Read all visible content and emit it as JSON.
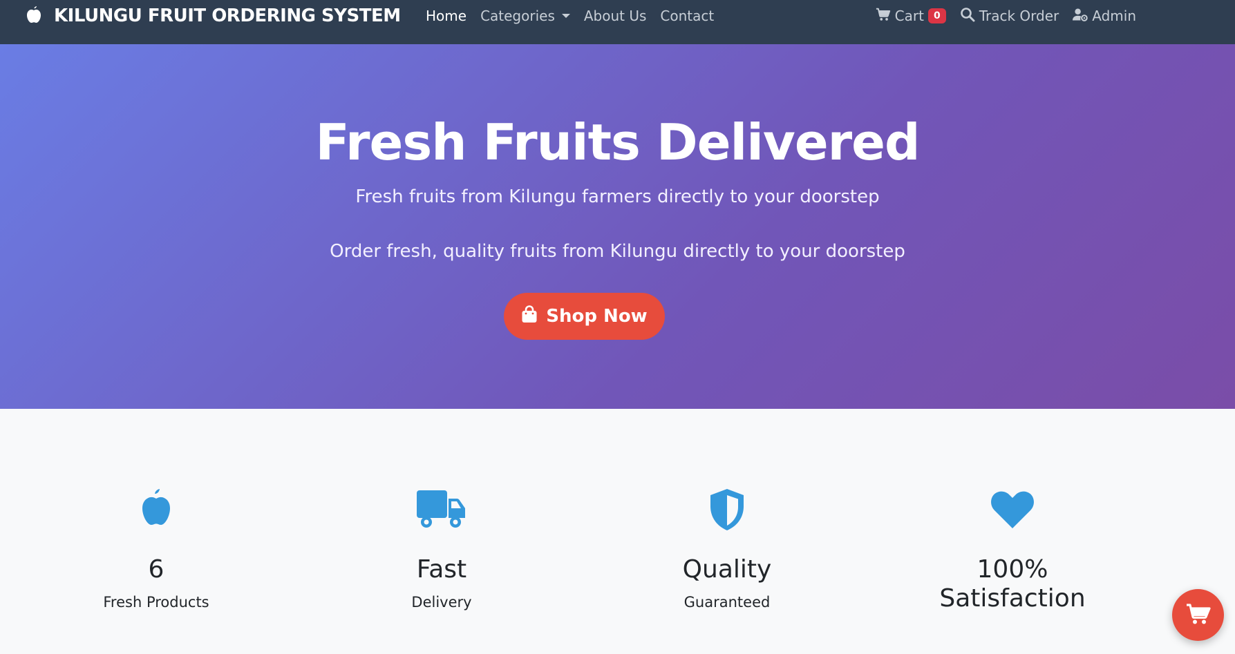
{
  "navbar": {
    "brand": "KILUNGU FRUIT ORDERING SYSTEM",
    "brand_icon": "apple-icon",
    "links": [
      {
        "label": "Home",
        "active": true
      },
      {
        "label": "Categories",
        "dropdown": true
      },
      {
        "label": "About Us"
      },
      {
        "label": "Contact"
      }
    ],
    "cart_label": "Cart",
    "cart_count": "0",
    "track_label": "Track Order",
    "admin_label": "Admin"
  },
  "hero": {
    "title": "Fresh Fruits Delivered",
    "subtitle": "Fresh fruits from Kilungu farmers directly to your doorstep",
    "tagline": "Order fresh, quality fruits from Kilungu directly to your doorstep",
    "button_label": "Shop Now",
    "button_icon": "shopping-bag-icon"
  },
  "features": [
    {
      "icon": "apple-icon",
      "title": "6",
      "desc": "Fresh Products"
    },
    {
      "icon": "truck-icon",
      "title": "Fast",
      "desc": "Delivery"
    },
    {
      "icon": "shield-icon",
      "title": "Quality",
      "desc": "Guaranteed"
    },
    {
      "icon": "heart-icon",
      "title": "100%\nSatisfaction",
      "desc": ""
    }
  ],
  "colors": {
    "navbar_bg": "#2f3e51",
    "hero_start": "#6a7de4",
    "hero_end": "#7a4da8",
    "accent_red": "#e74c3c",
    "badge_red": "#dc3545",
    "feature_icon": "#3498db"
  },
  "floating_cart_icon": "shopping-cart-icon"
}
